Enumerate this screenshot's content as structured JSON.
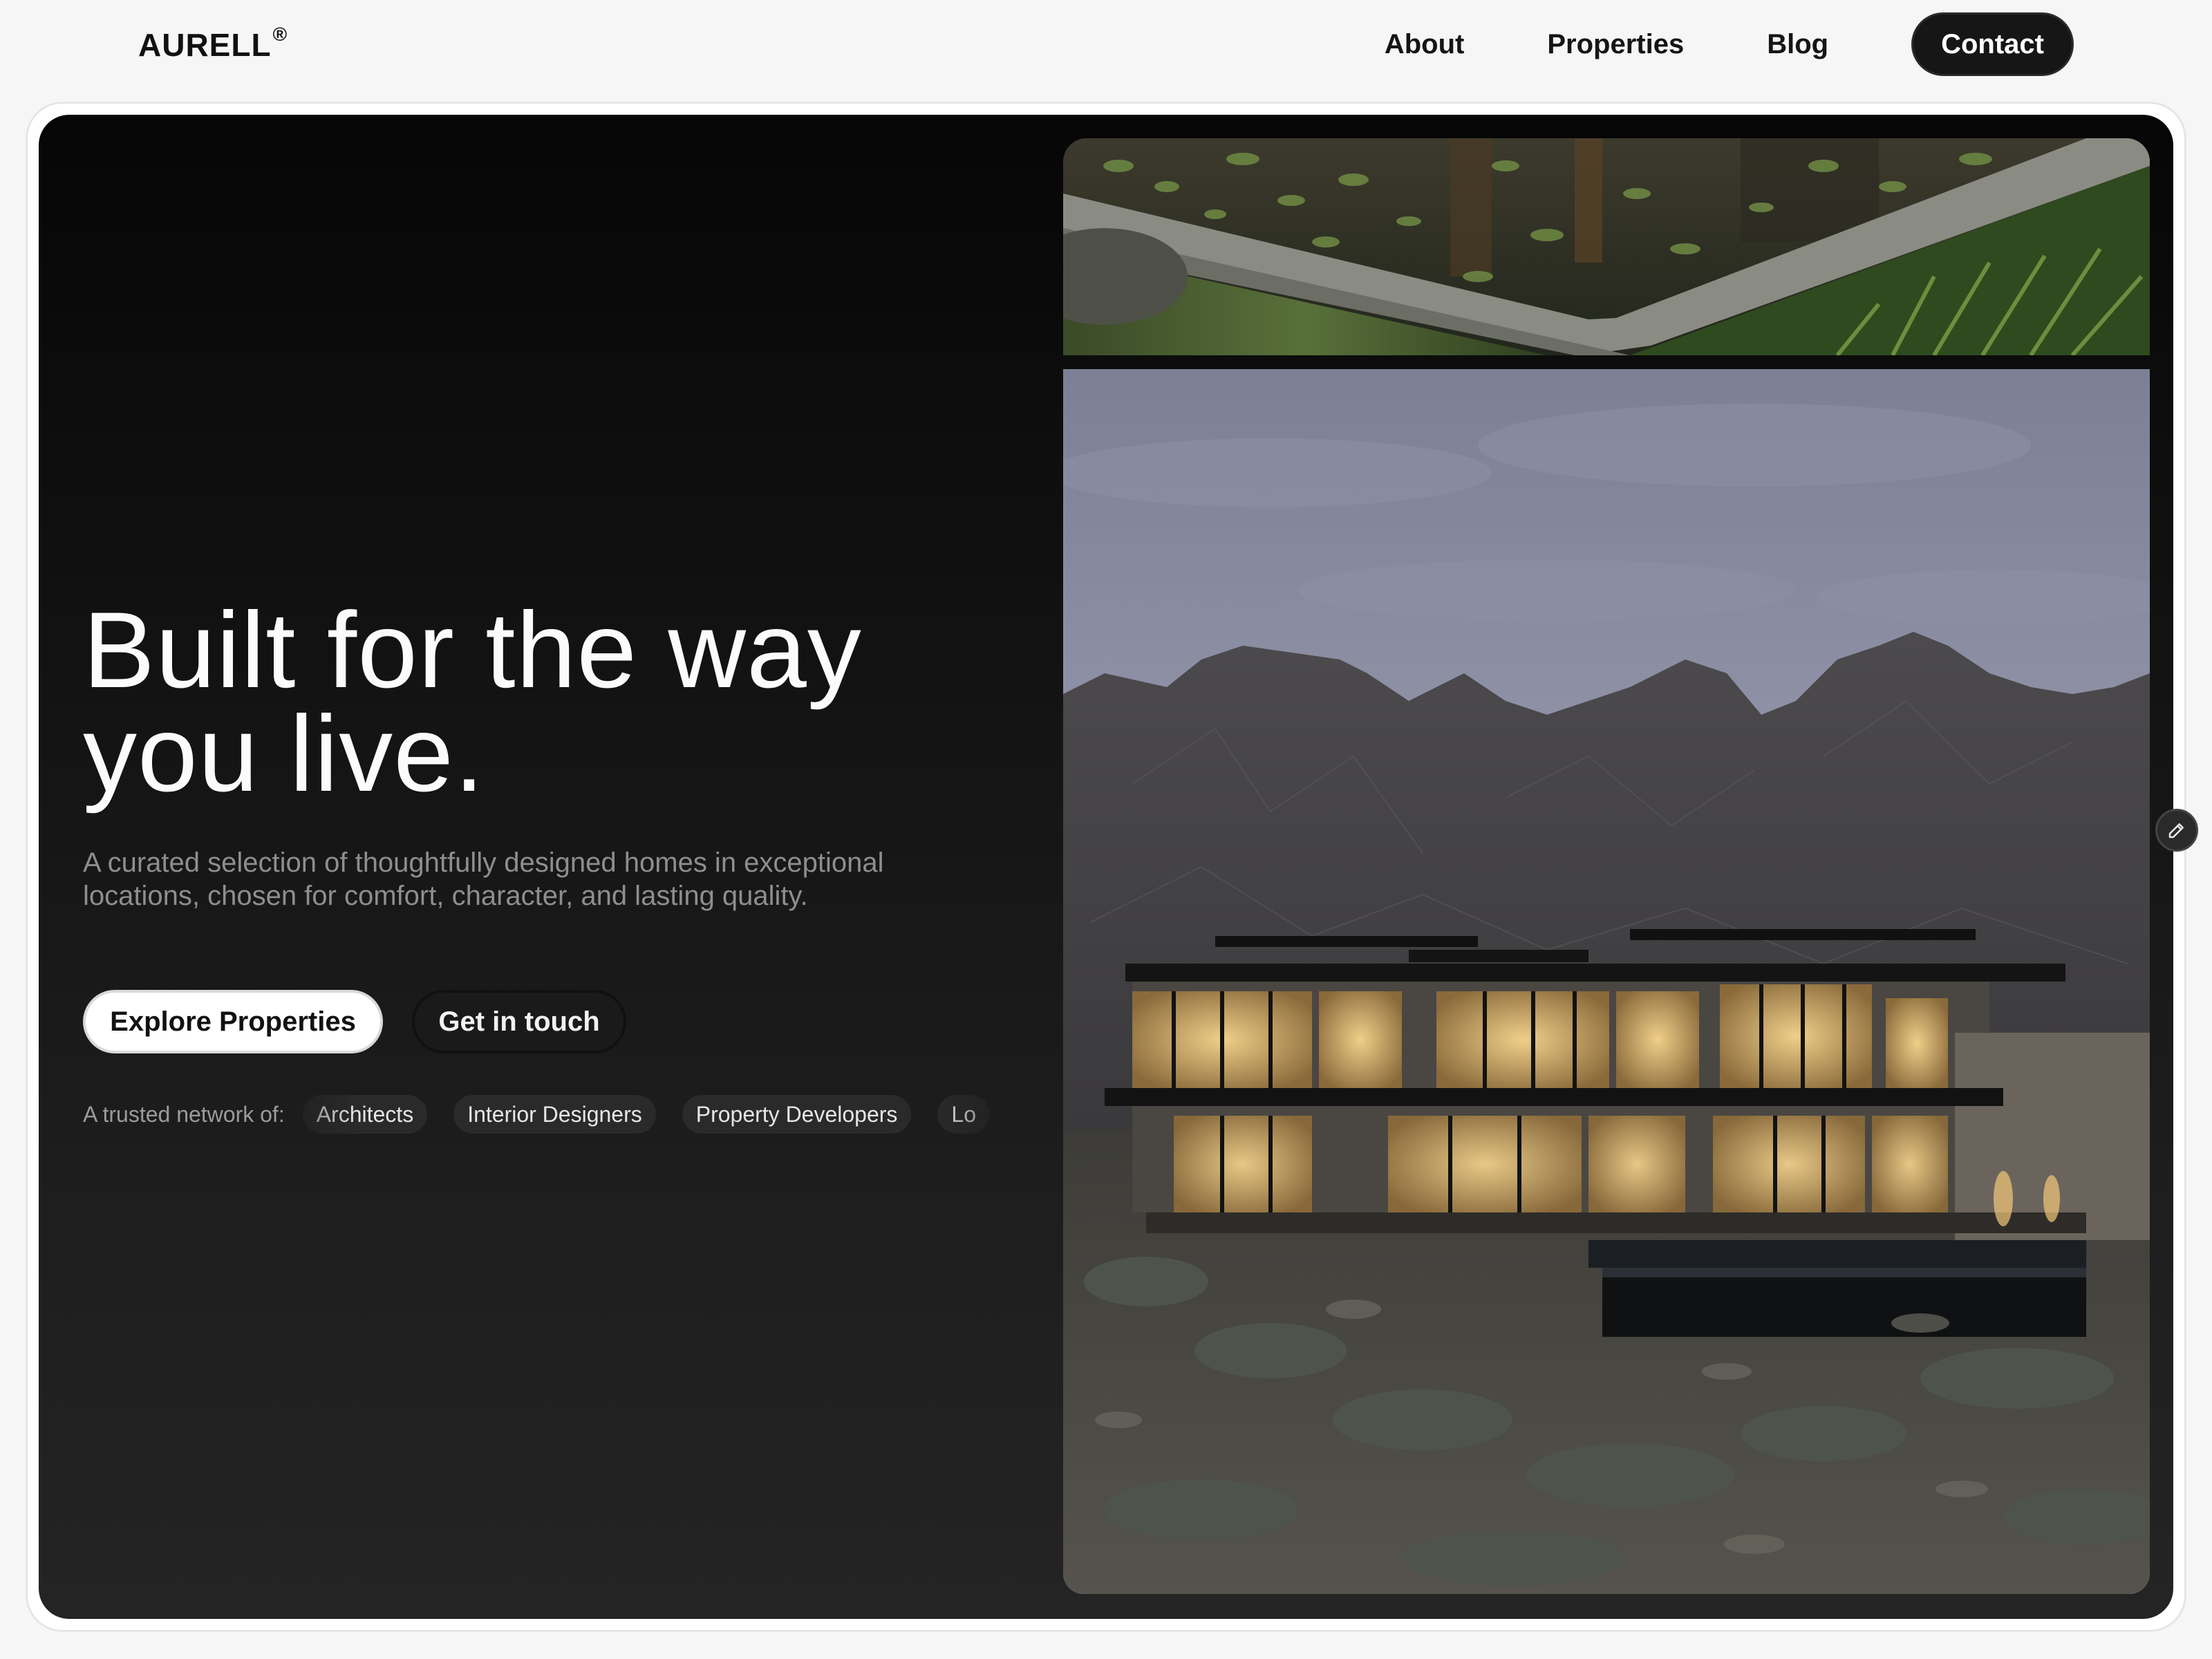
{
  "brand": {
    "name": "AURELL",
    "mark": "®"
  },
  "nav": {
    "links": [
      "About",
      "Properties",
      "Blog"
    ],
    "cta": "Contact"
  },
  "hero": {
    "headline": "Built for the way you live.",
    "subtitle": "A curated selection of thoughtfully designed homes in exceptional locations, chosen for comfort, character, and lasting quality.",
    "primary_button": "Explore Properties",
    "secondary_button": "Get in touch",
    "trusted_label": "A trusted network of:",
    "trusted_chips": [
      "Architects",
      "Interior Designers",
      "Property Developers",
      "Lo"
    ]
  },
  "colors": {
    "accent": "#161616",
    "page_background": "#f6f6f6",
    "hero_background": "#121212"
  },
  "icons": {
    "floating_action": "pencil-icon"
  }
}
